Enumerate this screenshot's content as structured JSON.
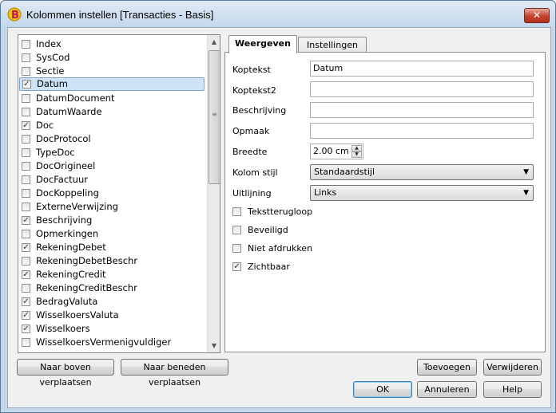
{
  "window": {
    "title": "Kolommen instellen [Transacties - Basis]",
    "close_glyph": "✕"
  },
  "columns": [
    {
      "label": "Index",
      "checked": false
    },
    {
      "label": "SysCod",
      "checked": false
    },
    {
      "label": "Sectie",
      "checked": false
    },
    {
      "label": "Datum",
      "checked": true,
      "selected": true
    },
    {
      "label": "DatumDocument",
      "checked": false
    },
    {
      "label": "DatumWaarde",
      "checked": false
    },
    {
      "label": "Doc",
      "checked": true
    },
    {
      "label": "DocProtocol",
      "checked": false
    },
    {
      "label": "TypeDoc",
      "checked": false
    },
    {
      "label": "DocOrigineel",
      "checked": false
    },
    {
      "label": "DocFactuur",
      "checked": false
    },
    {
      "label": "DocKoppeling",
      "checked": false
    },
    {
      "label": "ExterneVerwijzing",
      "checked": false
    },
    {
      "label": "Beschrijving",
      "checked": true
    },
    {
      "label": "Opmerkingen",
      "checked": false
    },
    {
      "label": "RekeningDebet",
      "checked": true
    },
    {
      "label": "RekeningDebetBeschr",
      "checked": false
    },
    {
      "label": "RekeningCredit",
      "checked": true
    },
    {
      "label": "RekeningCreditBeschr",
      "checked": false
    },
    {
      "label": "BedragValuta",
      "checked": true
    },
    {
      "label": "WisselkoersValuta",
      "checked": true
    },
    {
      "label": "Wisselkoers",
      "checked": true
    },
    {
      "label": "WisselkoersVermenigvuldiger",
      "checked": false
    }
  ],
  "list_buttons": {
    "move_up": "Naar boven verplaatsen",
    "move_down": "Naar beneden verplaatsen"
  },
  "tabs": {
    "display": "Weergeven",
    "settings": "Instellingen"
  },
  "form": {
    "header_label": "Koptekst",
    "header_value": "Datum",
    "header2_label": "Koptekst2",
    "header2_value": "",
    "description_label": "Beschrijving",
    "description_value": "",
    "format_label": "Opmaak",
    "format_value": "",
    "width_label": "Breedte",
    "width_value": "2.00 cm",
    "style_label": "Kolom stijl",
    "style_value": "Standaardstijl",
    "alignment_label": "Uitlijning",
    "alignment_value": "Links"
  },
  "options": [
    {
      "label": "Tekstterugloop",
      "checked": false
    },
    {
      "label": "Beveiligd",
      "checked": false
    },
    {
      "label": "Niet afdrukken",
      "checked": false
    },
    {
      "label": "Zichtbaar",
      "checked": true
    }
  ],
  "buttons": {
    "add": "Toevoegen",
    "remove": "Verwijderen",
    "ok": "OK",
    "cancel": "Annuleren",
    "help": "Help"
  },
  "glyphs": {
    "check": "✓",
    "arrow_up": "▲",
    "arrow_down": "▼",
    "combo_arrow": "▼",
    "grip": "≡"
  }
}
